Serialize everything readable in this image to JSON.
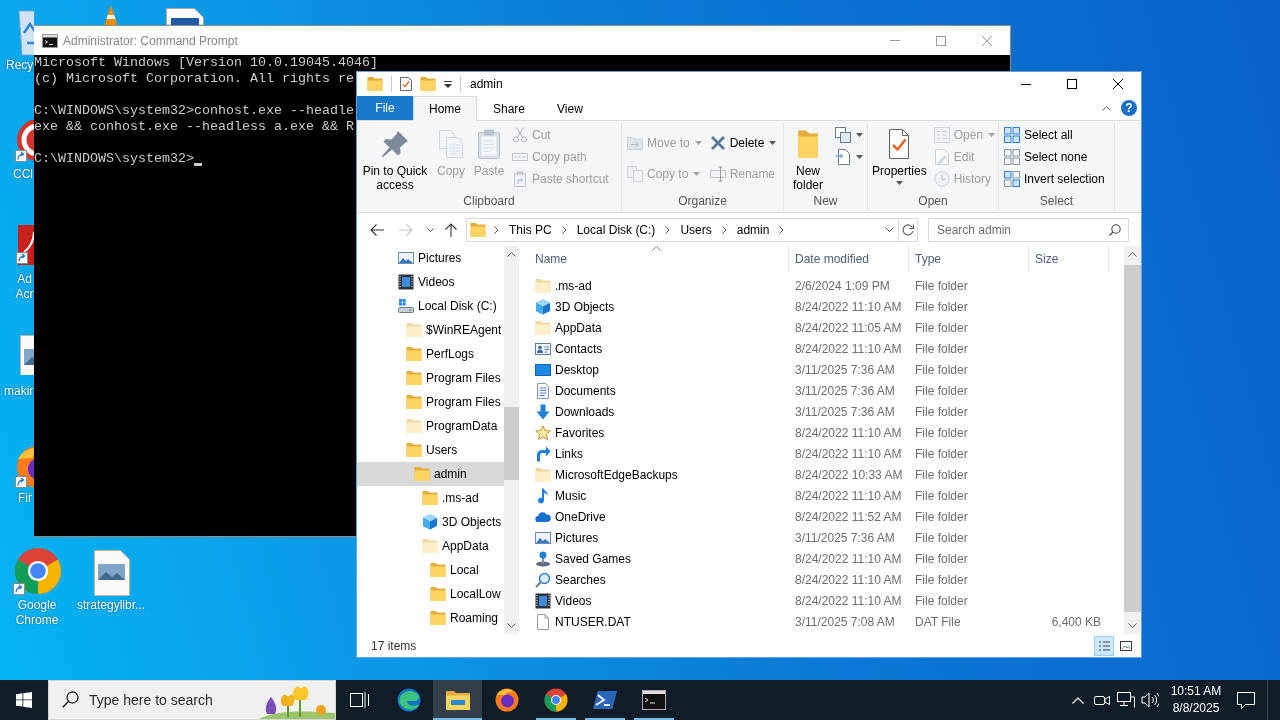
{
  "desktop": {
    "icons": [
      {
        "label": "Recy",
        "kind": "recycle"
      },
      {
        "label": "CCl",
        "kind": "cleaner"
      },
      {
        "label": "Ad Acr",
        "kind": "pdf"
      },
      {
        "label": "makir",
        "kind": "image"
      },
      {
        "label": "Fir",
        "kind": "firefox"
      },
      {
        "label": "Google Chrome",
        "kind": "chrome"
      },
      {
        "label": "strategylibr...",
        "kind": "image"
      }
    ]
  },
  "cmd": {
    "title": "Administrator: Command Prompt",
    "blocks": [
      [
        "Microsoft Windows [Version 10.0.19045.4046]",
        "(c) Microsoft Corporation. All rights re"
      ],
      [
        "C:\\WINDOWS\\system32>conhost.exe --headle",
        "exe && conhost.exe --headless a.exe && R"
      ],
      [
        "C:\\WINDOWS\\system32>"
      ]
    ],
    "cursor": true
  },
  "explorer": {
    "title": "admin",
    "tabs": [
      {
        "label": "File",
        "kind": "menu",
        "selected": false
      },
      {
        "label": "Home",
        "kind": "tab",
        "selected": true
      },
      {
        "label": "Share",
        "kind": "tab",
        "selected": false
      },
      {
        "label": "View",
        "kind": "tab",
        "selected": false
      }
    ],
    "help": "?",
    "groups": [
      {
        "label": "Clipboard",
        "columns": [
          {
            "kind": "large",
            "buttons": [
              {
                "label": "Pin to Quick access",
                "kind": "pin",
                "disabled": false,
                "dropdown": false
              }
            ]
          },
          {
            "kind": "large",
            "buttons": [
              {
                "label": "Copy",
                "kind": "copy",
                "disabled": true,
                "dropdown": false
              }
            ]
          },
          {
            "kind": "large",
            "buttons": [
              {
                "label": "Paste",
                "kind": "paste",
                "disabled": true,
                "dropdown": false
              }
            ]
          },
          {
            "kind": "small",
            "buttons": [
              {
                "label": "Cut",
                "kind": "cut",
                "disabled": true,
                "dropdown": false
              },
              {
                "label": "Copy path",
                "kind": "path",
                "disabled": true,
                "dropdown": false
              },
              {
                "label": "Paste shortcut",
                "kind": "shortcut",
                "disabled": true,
                "dropdown": false
              }
            ]
          }
        ]
      },
      {
        "label": "Organize",
        "columns": [
          {
            "kind": "small",
            "buttons": [
              {
                "label": "Move to",
                "kind": "move",
                "disabled": true,
                "dropdown": true
              },
              {
                "label": "Copy to",
                "kind": "copyto",
                "disabled": true,
                "dropdown": true
              }
            ]
          },
          {
            "kind": "small",
            "buttons": [
              {
                "label": "Delete",
                "kind": "delete",
                "disabled": false,
                "dropdown": true
              },
              {
                "label": "Rename",
                "kind": "rename",
                "disabled": true,
                "dropdown": false
              }
            ]
          }
        ]
      },
      {
        "label": "New",
        "columns": [
          {
            "kind": "large",
            "buttons": [
              {
                "label": "New folder",
                "kind": "newfolder",
                "disabled": false,
                "dropdown": false
              }
            ]
          },
          {
            "kind": "small",
            "buttons": [
              {
                "kind": "newitem",
                "disabled": false,
                "dropdown": true
              },
              {
                "kind": "easyaccess",
                "disabled": false,
                "dropdown": true
              }
            ]
          }
        ]
      },
      {
        "label": "Open",
        "columns": [
          {
            "kind": "large",
            "buttons": [
              {
                "label": "Properties",
                "kind": "properties",
                "disabled": false,
                "dropdown": true
              }
            ]
          },
          {
            "kind": "small",
            "buttons": [
              {
                "label": "Open",
                "kind": "open",
                "disabled": true,
                "dropdown": true
              },
              {
                "label": "Edit",
                "kind": "edit",
                "disabled": true,
                "dropdown": false
              },
              {
                "label": "History",
                "kind": "history",
                "disabled": true,
                "dropdown": false
              }
            ]
          }
        ]
      },
      {
        "label": "Select",
        "columns": [
          {
            "kind": "small",
            "buttons": [
              {
                "label": "Select all",
                "kind": "selectall",
                "disabled": false,
                "dropdown": false
              },
              {
                "label": "Select none",
                "kind": "selectnone",
                "disabled": false,
                "dropdown": false
              },
              {
                "label": "Invert selection",
                "kind": "invert",
                "disabled": false,
                "dropdown": false
              }
            ]
          }
        ]
      }
    ],
    "back": {
      "disabled": false
    },
    "forward": {
      "disabled": true
    },
    "path": [
      "This PC",
      "Local Disk (C:)",
      "Users",
      "admin"
    ],
    "search": {
      "placeholder": "Search admin"
    },
    "tree": [
      {
        "label": "Pictures",
        "kind": "pictures",
        "selected": false
      },
      {
        "label": "Videos",
        "kind": "videos",
        "selected": false
      },
      {
        "label": "Local Disk (C:)",
        "kind": "drive",
        "selected": false,
        "children": [
          {
            "label": "$WinREAgent",
            "kind": "hidden",
            "selected": false
          },
          {
            "label": "PerfLogs",
            "kind": "folder",
            "selected": false
          },
          {
            "label": "Program Files",
            "kind": "folder",
            "selected": false
          },
          {
            "label": "Program Files",
            "kind": "folder",
            "selected": false
          },
          {
            "label": "ProgramData",
            "kind": "hidden",
            "selected": false
          },
          {
            "label": "Users",
            "kind": "folder",
            "selected": false,
            "children": [
              {
                "label": "admin",
                "kind": "folder",
                "selected": true,
                "children": [
                  {
                    "label": ".ms-ad",
                    "kind": "folder",
                    "selected": false
                  },
                  {
                    "label": "3D Objects",
                    "kind": "cube",
                    "selected": false
                  },
                  {
                    "label": "AppData",
                    "kind": "hidden",
                    "selected": false,
                    "children": [
                      {
                        "label": "Local",
                        "kind": "folder",
                        "selected": false
                      },
                      {
                        "label": "LocalLow",
                        "kind": "folder",
                        "selected": false
                      },
                      {
                        "label": "Roaming",
                        "kind": "folder",
                        "selected": false
                      }
                    ]
                  }
                ]
              }
            ]
          }
        ]
      }
    ],
    "columns": [
      {
        "label": "Name",
        "sorted": true
      },
      {
        "label": "Date modified",
        "sorted": false
      },
      {
        "label": "Type",
        "sorted": false
      },
      {
        "label": "Size",
        "sorted": false
      }
    ],
    "rows": [
      {
        "name": ".ms-ad",
        "kind": "hidden",
        "date": "2/6/2024 1:09 PM",
        "type": "File folder"
      },
      {
        "name": "3D Objects",
        "kind": "cube",
        "date": "8/24/2022 11:10 AM",
        "type": "File folder"
      },
      {
        "name": "AppData",
        "kind": "hidden",
        "date": "8/24/2022 11:05 AM",
        "type": "File folder"
      },
      {
        "name": "Contacts",
        "kind": "contacts",
        "date": "8/24/2022 11:10 AM",
        "type": "File folder"
      },
      {
        "name": "Desktop",
        "kind": "desktop",
        "date": "3/11/2025 7:36 AM",
        "type": "File folder"
      },
      {
        "name": "Documents",
        "kind": "documents",
        "date": "3/11/2025 7:36 AM",
        "type": "File folder"
      },
      {
        "name": "Downloads",
        "kind": "downloads",
        "date": "3/11/2025 7:36 AM",
        "type": "File folder"
      },
      {
        "name": "Favorites",
        "kind": "favorites",
        "date": "8/24/2022 11:10 AM",
        "type": "File folder"
      },
      {
        "name": "Links",
        "kind": "links",
        "date": "8/24/2022 11:10 AM",
        "type": "File folder"
      },
      {
        "name": "MicrosoftEdgeBackups",
        "kind": "hidden",
        "date": "8/24/2022 10:33 AM",
        "type": "File folder"
      },
      {
        "name": "Music",
        "kind": "music",
        "date": "8/24/2022 11:10 AM",
        "type": "File folder"
      },
      {
        "name": "OneDrive",
        "kind": "onedrive",
        "date": "8/24/2022 11:52 AM",
        "type": "File folder"
      },
      {
        "name": "Pictures",
        "kind": "pictures",
        "date": "3/11/2025 7:36 AM",
        "type": "File folder"
      },
      {
        "name": "Saved Games",
        "kind": "games",
        "date": "8/24/2022 11:10 AM",
        "type": "File folder"
      },
      {
        "name": "Searches",
        "kind": "searches",
        "date": "8/24/2022 11:10 AM",
        "type": "File folder"
      },
      {
        "name": "Videos",
        "kind": "videos",
        "date": "8/24/2022 11:10 AM",
        "type": "File folder"
      },
      {
        "name": "NTUSER.DAT",
        "kind": "file",
        "date": "3/11/2025 7:08 AM",
        "type": "DAT File",
        "size": "6,400 KB"
      }
    ],
    "status": {
      "count": "17 items",
      "views": [
        {
          "kind": "details",
          "selected": true
        },
        {
          "kind": "tiles",
          "selected": false
        }
      ]
    }
  },
  "taskbar": {
    "search": {
      "placeholder": "Type here to search"
    },
    "apps": [
      {
        "kind": "edge",
        "active": false,
        "running": false
      },
      {
        "kind": "explorer",
        "active": true,
        "running": true
      },
      {
        "kind": "firefox",
        "active": false,
        "running": false
      },
      {
        "kind": "chrome",
        "active": false,
        "running": true
      },
      {
        "kind": "powershell",
        "active": false,
        "running": true
      },
      {
        "kind": "cmd",
        "active": false,
        "running": true
      }
    ],
    "clock": {
      "time": "10:51 AM",
      "date": "8/8/2025"
    }
  }
}
